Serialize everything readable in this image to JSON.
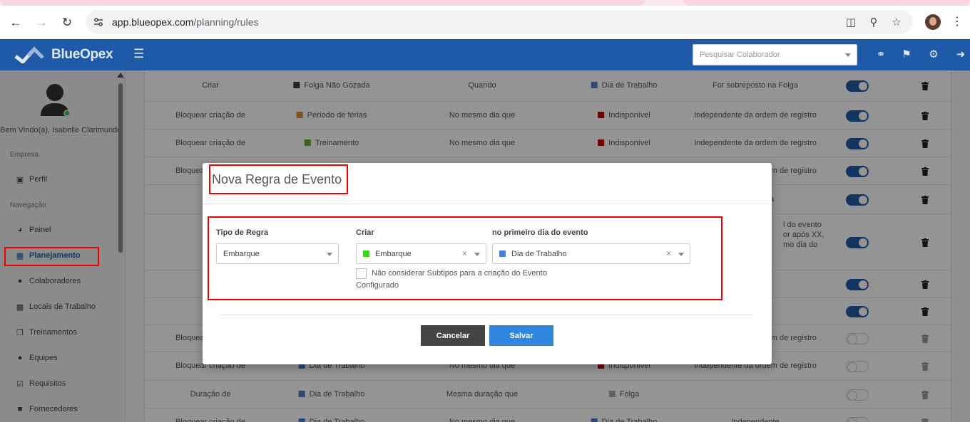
{
  "browser": {
    "url_host": "app.blueopex.com",
    "url_path": "/planning/rules"
  },
  "header": {
    "brand": "BlueOpex",
    "search_placeholder": "Pesquisar Colaborador"
  },
  "sidebar": {
    "welcome": "Bem Vindo(a), Isabelle Clarimundo",
    "section_company": "Empresa",
    "section_nav": "Navegação",
    "items": [
      {
        "label": "Perfil"
      },
      {
        "label": "Painel"
      },
      {
        "label": "Planejamento"
      },
      {
        "label": "Colaboradores"
      },
      {
        "label": "Locais de Trabalho"
      },
      {
        "label": "Treinamentos"
      },
      {
        "label": "Equipes"
      },
      {
        "label": "Requisitos"
      },
      {
        "label": "Fornecedores"
      }
    ]
  },
  "table": {
    "rows": [
      {
        "action": "Criar",
        "event1": "Folga Não Gozada",
        "color1": "#4a3b2e",
        "relation": "Quando",
        "event2": "Dia de Trabalho",
        "color2": "#4a7fd4",
        "condition": "For sobreposto na Folga",
        "active": true
      },
      {
        "action": "Bloquear criação de",
        "event1": "Período de férias",
        "color1": "#e08a2e",
        "relation": "No mesmo dia que",
        "event2": "Indisponível",
        "color2": "#c00000",
        "condition": "Independente da ordem de registro",
        "active": true
      },
      {
        "action": "Bloquear criação de",
        "event1": "Treinamento",
        "color1": "#6aa83a",
        "relation": "No mesmo dia que",
        "event2": "Indisponível",
        "color2": "#c00000",
        "condition": "Independente da ordem de registro",
        "active": true
      },
      {
        "action": "Bloquear criação de",
        "event1": "",
        "color1": "",
        "relation": "",
        "event2": "",
        "color2": "",
        "condition": "Independente da ordem de registro",
        "active": true
      },
      {
        "action": "",
        "event1": "",
        "color1": "",
        "relation": "",
        "event2": "",
        "color2": "",
        "condition": "onfigurada",
        "active": true
      },
      {
        "action": "",
        "event1": "",
        "color1": "",
        "relation": "",
        "event2": "",
        "color2": "",
        "condition": "l do evento\nor após XX,\nmo dia do",
        "active": true
      },
      {
        "action": "",
        "event1": "",
        "color1": "",
        "relation": "",
        "event2": "",
        "color2": "",
        "condition": "",
        "active": true
      },
      {
        "action": "",
        "event1": "",
        "color1": "",
        "relation": "",
        "event2": "",
        "color2": "",
        "condition": "",
        "active": true
      },
      {
        "action": "Bloquear criação de",
        "event1": "",
        "color1": "",
        "relation": "",
        "event2": "",
        "color2": "",
        "condition": "Independente da ordem de registro",
        "active": false
      },
      {
        "action": "Bloquear criação de",
        "event1": "Dia de Trabalho",
        "color1": "#4a7fd4",
        "relation": "No mesmo dia que",
        "event2": "Indisponível",
        "color2": "#c00000",
        "condition": "Independente da ordem de registro",
        "active": false
      },
      {
        "action": "Duração de",
        "event1": "Dia de Trabalho",
        "color1": "#4a7fd4",
        "relation": "Mesma duração que",
        "event2": "Folga",
        "color2": "#aaaaaa",
        "condition": "",
        "active": false
      },
      {
        "action": "Bloquear criação de",
        "event1": "Dia de Trabalho",
        "color1": "#4a7fd4",
        "relation": "No mesmo dia que",
        "event2": "Dia de Trabalho",
        "color2": "#4a7fd4",
        "condition": "Independente",
        "active": false
      }
    ]
  },
  "modal": {
    "title": "Nova Regra de Evento",
    "rule_type_label": "Tipo de Regra",
    "rule_type_value": "Embarque",
    "create_label": "Criar",
    "create_value": "Embarque",
    "create_color": "#33dd11",
    "first_day_label": "no primeiro dia do evento",
    "first_day_value": "Dia de Trabalho",
    "first_day_color": "#4a7fd4",
    "checkbox_label_line1": "Não considerar Subtipos para a criação do Evento",
    "checkbox_label_line2": "Configurado",
    "cancel_label": "Cancelar",
    "save_label": "Salvar"
  }
}
